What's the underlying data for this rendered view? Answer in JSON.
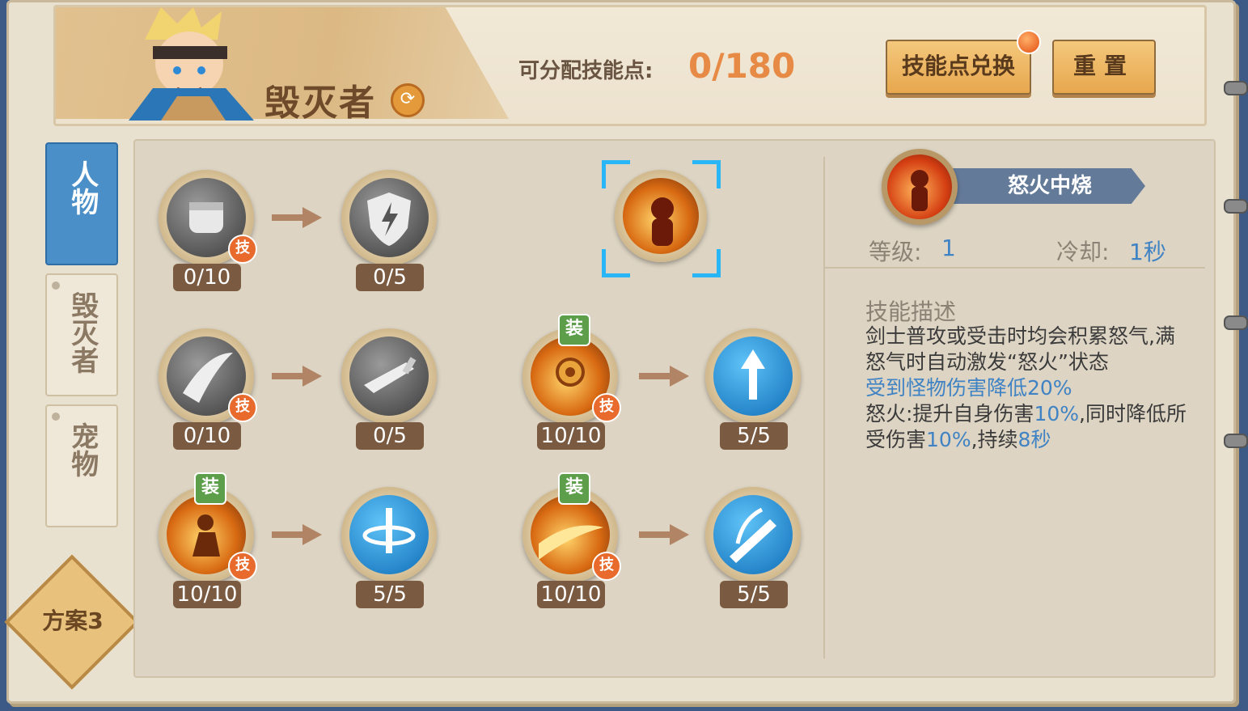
{
  "header": {
    "class_name": "毁灭者",
    "points_label": "可分配技能点:",
    "points_value": "0/180",
    "exchange_button": "技能点兑换",
    "reset_button": "重置"
  },
  "tabs": [
    {
      "label": "人物",
      "active": true
    },
    {
      "label": "毁灭者",
      "active": false
    },
    {
      "label": "宠物",
      "active": false
    }
  ],
  "plan_label": "方案3",
  "skills": {
    "r1c1": {
      "level": "0/10",
      "badge": "技"
    },
    "r1c2": {
      "level": "0/5"
    },
    "r2c1": {
      "level": "0/10",
      "badge": "技"
    },
    "r2c2": {
      "level": "0/5"
    },
    "r2c3": {
      "level": "10/10",
      "badge": "技",
      "tag": "装"
    },
    "r2c4": {
      "level": "5/5"
    },
    "r3c1": {
      "level": "10/10",
      "badge": "技",
      "tag": "装"
    },
    "r3c2": {
      "level": "5/5"
    },
    "r3c3": {
      "level": "10/10",
      "badge": "技",
      "tag": "装"
    },
    "r3c4": {
      "level": "5/5"
    }
  },
  "detail": {
    "skill_name": "怒火中烧",
    "level_label": "等级:",
    "level_value": "1",
    "cooldown_label": "冷却:",
    "cooldown_value": "1秒",
    "desc_title": "技能描述",
    "desc_line1": "剑士普攻或受击时均会积累怒气,满怒气时自动激发“怒火”状态",
    "desc_line2": "受到怪物伤害降低20%",
    "desc_line3_a": "怒火:提升自身伤害",
    "desc_line3_b": "10%",
    "desc_line3_c": ",同时降低所受伤害",
    "desc_line3_d": "10%",
    "desc_line3_e": ",持续",
    "desc_line3_f": "8秒"
  },
  "colors": {
    "accent_orange": "#e68a45",
    "tab_blue": "#4b8fc9",
    "value_blue": "#3f83c4"
  }
}
